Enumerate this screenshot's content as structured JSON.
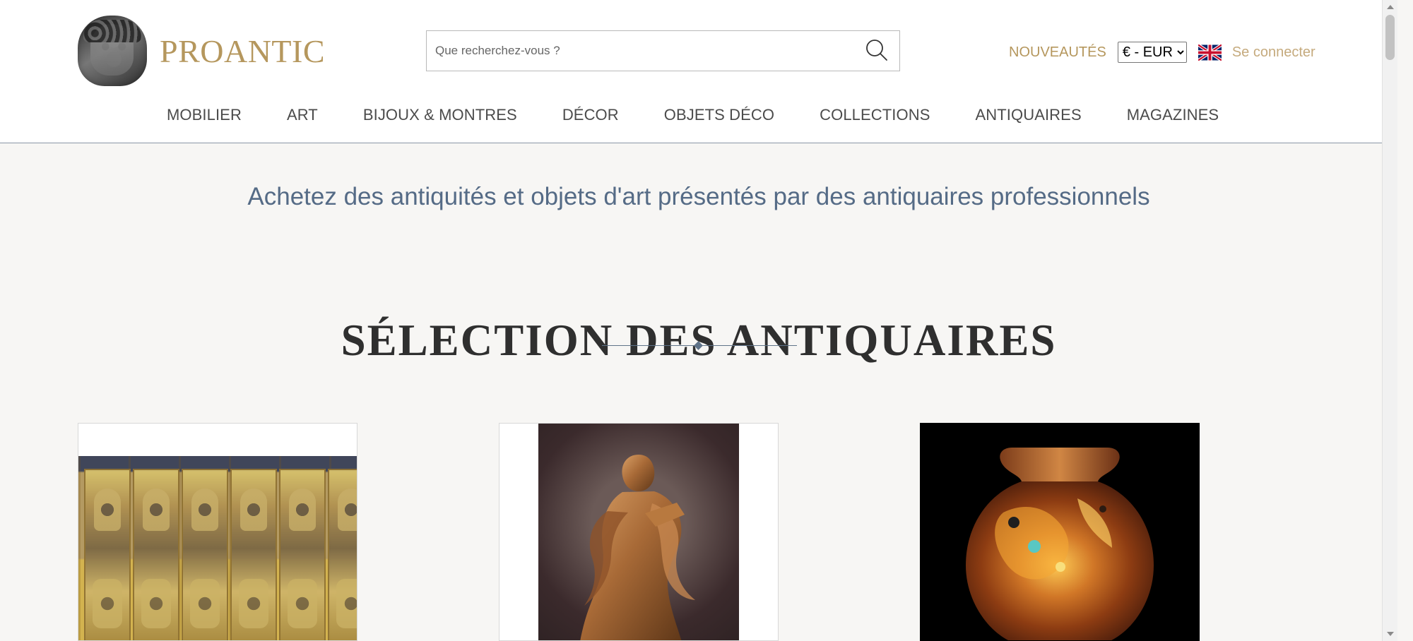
{
  "brand": {
    "name": "PROANTIC"
  },
  "search": {
    "placeholder": "Que recherchez-vous ?",
    "icon": "search-icon"
  },
  "header": {
    "new_link": "NOUVEAUTÉS",
    "currency_selected": "€ - EUR",
    "language_flag": "uk-flag-icon",
    "signin": "Se connecter"
  },
  "nav": {
    "items": [
      {
        "label": "MOBILIER"
      },
      {
        "label": "ART"
      },
      {
        "label": "BIJOUX & MONTRES"
      },
      {
        "label": "DÉCOR"
      },
      {
        "label": "OBJETS DÉCO"
      },
      {
        "label": "COLLECTIONS"
      },
      {
        "label": "ANTIQUAIRES"
      },
      {
        "label": "MAGAZINES"
      }
    ]
  },
  "main": {
    "tagline": "Achetez des antiquités et objets d'art présentés par des antiquaires professionnels",
    "section_title": "SÉLECTION DES ANTIQUAIRES"
  },
  "cards": [
    {
      "image": "folding-screen-image"
    },
    {
      "image": "wood-sculpture-image"
    },
    {
      "image": "glass-vase-image"
    }
  ],
  "colors": {
    "brand_gold": "#b5975d",
    "muted_gold": "#c5aa7d",
    "slate_blue": "#556b86",
    "page_background": "#f7f6f4",
    "header_background": "#ffffff",
    "nav_text": "#4b4b4b"
  }
}
